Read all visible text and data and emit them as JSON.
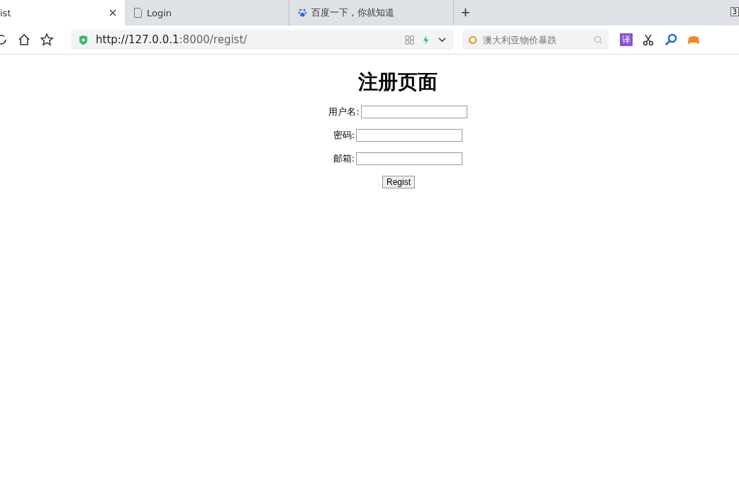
{
  "tabs": [
    {
      "label": "ist",
      "selected": true
    },
    {
      "label": "Login",
      "selected": false
    },
    {
      "label": "百度一下，你就知道",
      "selected": false
    }
  ],
  "new_tab": "+",
  "window_badge": "3",
  "address_bar": {
    "url_host": "http://127.0.0.1",
    "url_rest": ":8000/regist/"
  },
  "search": {
    "placeholder": "澳大利亚物价暴跌"
  },
  "translate_button": "译",
  "page": {
    "heading": "注册页面",
    "fields": [
      {
        "label": "用户名:"
      },
      {
        "label": "密码:"
      },
      {
        "label": "邮箱:"
      }
    ],
    "submit": "Regist"
  }
}
